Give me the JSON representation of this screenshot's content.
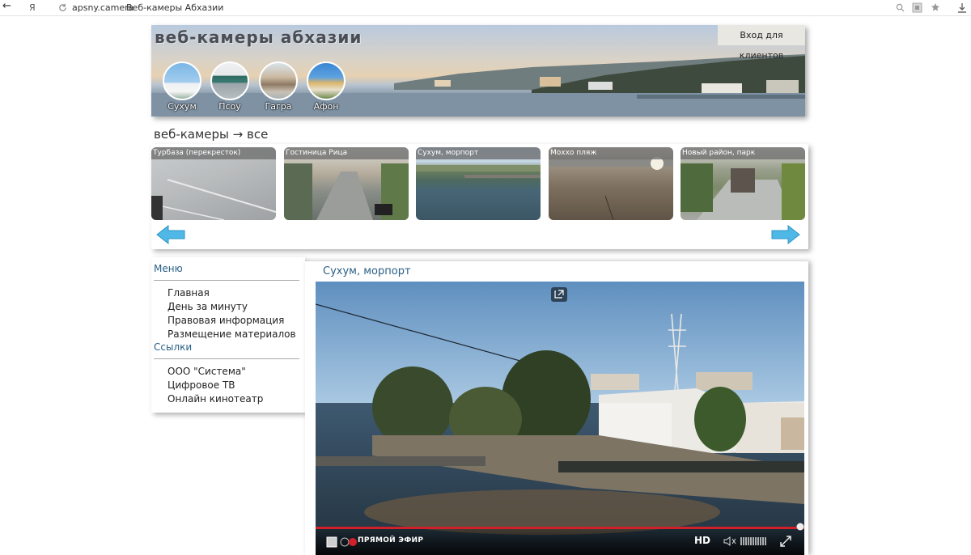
{
  "browser": {
    "back_label": "←",
    "yandex_logo": "Я",
    "url": "apsny.camera",
    "tab_title": "Веб-камеры Абхазии"
  },
  "header": {
    "title": "веб-камеры абхазии",
    "login_label": "Вход для клиентов",
    "cities": [
      {
        "label": "Сухум"
      },
      {
        "label": "Псоу"
      },
      {
        "label": "Гагра"
      },
      {
        "label": "Афон"
      }
    ]
  },
  "cameras_section": {
    "title": "веб-камеры → все",
    "thumbs": [
      {
        "caption": "Турбаза (перекресток)"
      },
      {
        "caption": "Гостиница Рица"
      },
      {
        "caption": "Сухум, морпорт"
      },
      {
        "caption": "Моххо пляж"
      },
      {
        "caption": "Новый район, парк"
      }
    ]
  },
  "menu": {
    "heading": "Меню",
    "items": [
      {
        "label": "Главная"
      },
      {
        "label": "День за минуту"
      },
      {
        "label": "Правовая информация"
      },
      {
        "label": "Размещение материалов"
      }
    ],
    "links_heading": "Ссылки",
    "links": [
      {
        "label": "ООО \"Система\""
      },
      {
        "label": "Цифровое ТВ"
      },
      {
        "label": "Онлайн кинотеатр"
      }
    ]
  },
  "player": {
    "title": "Сухум, морпорт",
    "live_label": "ПРЯМОЙ ЭФИР",
    "hd_label": "HD"
  },
  "colors": {
    "accent": "#2a5f86",
    "progress": "#d0212a",
    "arrow": "#4fb8e6"
  },
  "icons": [
    "back-icon",
    "search-icon",
    "extension-icon",
    "star-icon",
    "download-icon",
    "external-link-icon",
    "play-icon",
    "record-icon",
    "volume-icon",
    "fullscreen-icon",
    "arrow-left-icon",
    "arrow-right-icon"
  ]
}
